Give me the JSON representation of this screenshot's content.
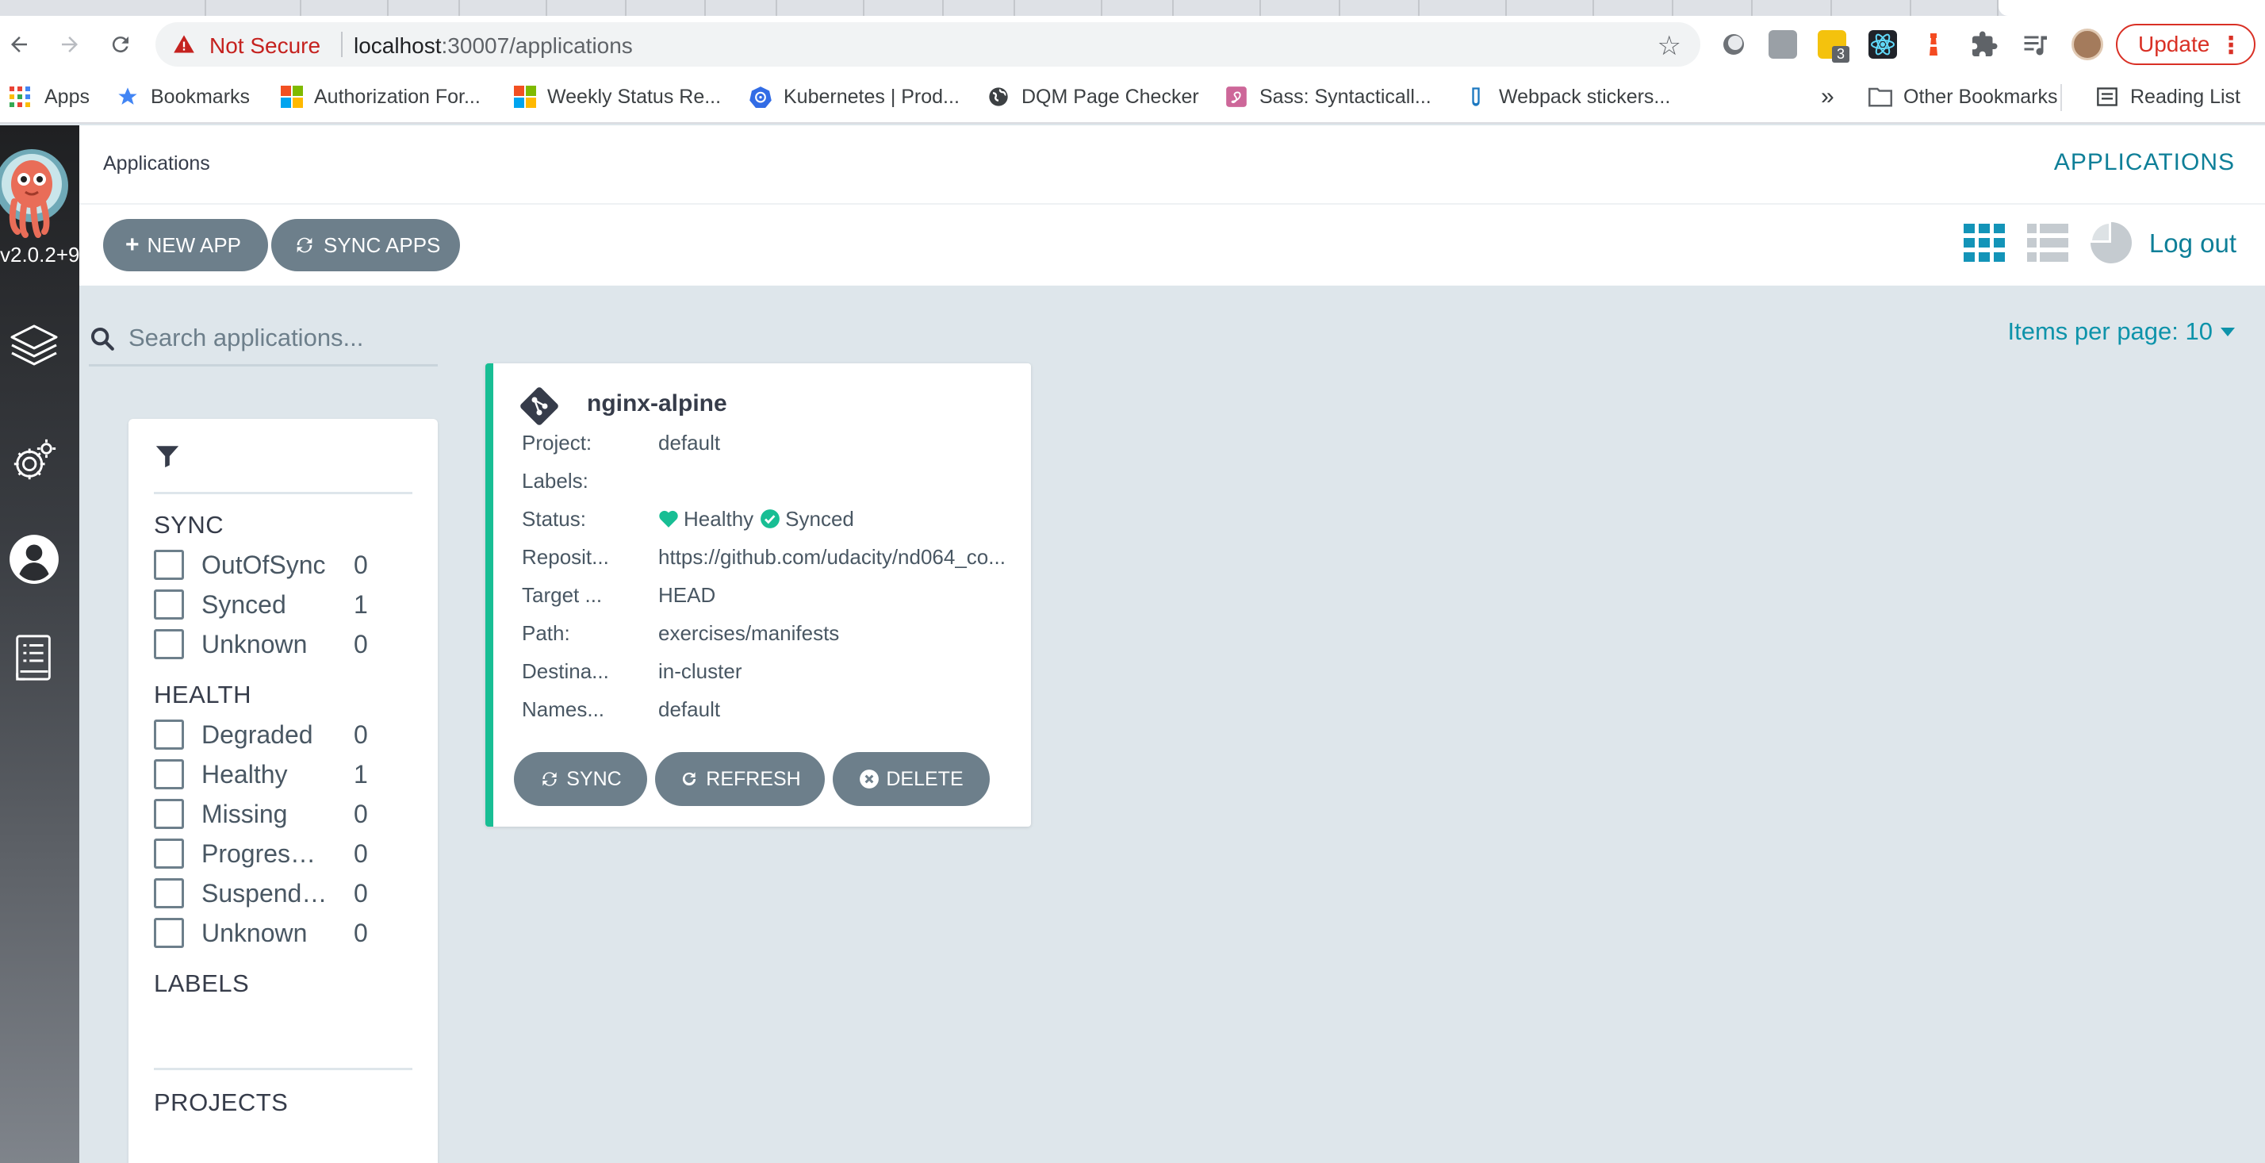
{
  "browser": {
    "security_label": "Not Secure",
    "url_host": "localhost",
    "url_path": ":30007/applications",
    "update_label": "Update",
    "extension_badge": "3",
    "bookmarks": [
      {
        "label": "Apps"
      },
      {
        "label": "Bookmarks"
      },
      {
        "label": "Authorization For..."
      },
      {
        "label": "Weekly Status Re..."
      },
      {
        "label": "Kubernetes | Prod..."
      },
      {
        "label": "DQM Page Checker"
      },
      {
        "label": "Sass: Syntacticall..."
      },
      {
        "label": "Webpack stickers..."
      }
    ],
    "overflow_label": "»",
    "other_bookmarks": "Other Bookmarks",
    "reading_list": "Reading List"
  },
  "sidebar": {
    "version": "v2.0.2+9",
    "items": [
      {
        "icon": "layers-icon"
      },
      {
        "icon": "settings-icon"
      },
      {
        "icon": "user-icon"
      },
      {
        "icon": "docs-icon"
      }
    ]
  },
  "header": {
    "breadcrumb": "Applications",
    "title": "APPLICATIONS"
  },
  "toolbar": {
    "new_app": "NEW APP",
    "sync_apps": "SYNC APPS",
    "logout": "Log out"
  },
  "search": {
    "placeholder": "Search applications..."
  },
  "pagination": {
    "items_per_page": "Items per page: 10"
  },
  "filters": {
    "sync_title": "SYNC",
    "sync": [
      {
        "label": "OutOfSync",
        "count": "0"
      },
      {
        "label": "Synced",
        "count": "1"
      },
      {
        "label": "Unknown",
        "count": "0"
      }
    ],
    "health_title": "HEALTH",
    "health": [
      {
        "label": "Degraded",
        "count": "0"
      },
      {
        "label": "Healthy",
        "count": "1"
      },
      {
        "label": "Missing",
        "count": "0"
      },
      {
        "label": "Progressi...",
        "count": "0"
      },
      {
        "label": "Suspended",
        "count": "0"
      },
      {
        "label": "Unknown",
        "count": "0"
      }
    ],
    "labels_title": "LABELS",
    "projects_title": "PROJECTS"
  },
  "app_card": {
    "name": "nginx-alpine",
    "accent_color": "#18be94",
    "rows": [
      {
        "key": "Project:",
        "value": "default"
      },
      {
        "key": "Labels:",
        "value": ""
      },
      {
        "key": "Status:",
        "value": ""
      },
      {
        "key": "Reposit...",
        "value": "https://github.com/udacity/nd064_co..."
      },
      {
        "key": "Target ...",
        "value": "HEAD"
      },
      {
        "key": "Path:",
        "value": "exercises/manifests"
      },
      {
        "key": "Destina...",
        "value": "in-cluster"
      },
      {
        "key": "Names...",
        "value": "default"
      }
    ],
    "health_status": "Healthy",
    "sync_status": "Synced",
    "buttons": {
      "sync": "SYNC",
      "refresh": "REFRESH",
      "delete": "DELETE"
    }
  }
}
